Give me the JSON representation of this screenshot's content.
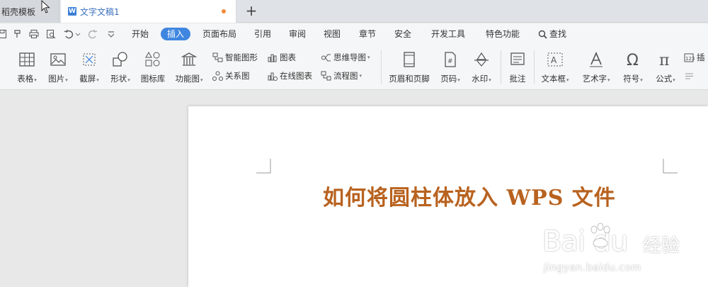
{
  "tabs": [
    {
      "label": "稻壳模板"
    },
    {
      "label": "文字文稿1"
    }
  ],
  "new_tab_label": "+",
  "menu": {
    "items": [
      "开始",
      "插入",
      "页面布局",
      "引用",
      "审阅",
      "视图",
      "章节",
      "安全",
      "开发工具",
      "特色功能"
    ],
    "active": "插入",
    "search_label": "查找"
  },
  "ribbon": {
    "table": "表格",
    "picture": "图片",
    "screenshot": "截屏",
    "shape": "形状",
    "icon_lib": "图标库",
    "func_chart": "功能图",
    "smart_art": "智能图形",
    "chart": "图表",
    "mind_map": "思维导图",
    "relation": "关系图",
    "online_chart": "在线图表",
    "flowchart": "流程图",
    "header_footer": "页眉和页脚",
    "page_number": "页码",
    "watermark": "水印",
    "comment": "批注",
    "textbox": "文本框",
    "word_art": "艺术字",
    "symbol": "符号",
    "formula": "公式",
    "insert_more": "插"
  },
  "document": {
    "title": "如何将圆柱体放入 WPS 文件"
  },
  "watermark": {
    "logo": "Bai du",
    "cn": "经验",
    "url": "jingyan.baidu.com"
  },
  "colors": {
    "accent": "#3f86e0",
    "title": "#b8621f",
    "modified_dot": "#f28a3c"
  }
}
